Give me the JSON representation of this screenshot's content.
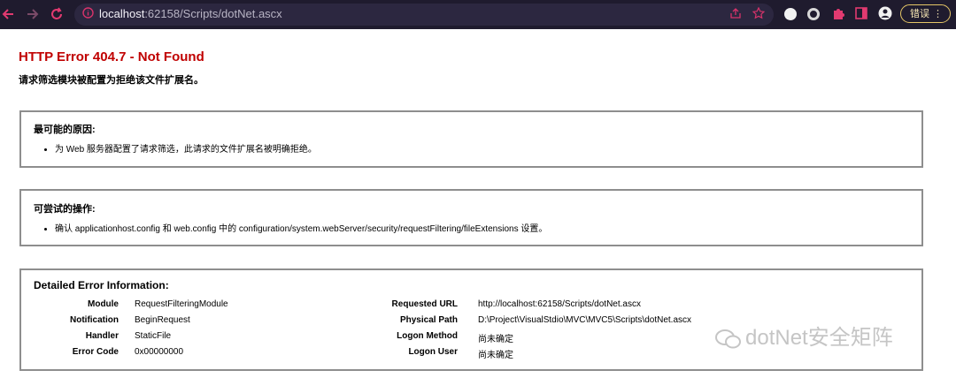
{
  "browser": {
    "url_host": "localhost",
    "url_rest": ":62158/Scripts/dotNet.ascx",
    "badge_label": "错误"
  },
  "error": {
    "title": "HTTP Error 404.7 - Not Found",
    "subtitle": "请求筛选模块被配置为拒绝该文件扩展名。"
  },
  "causes": {
    "heading": "最可能的原因:",
    "item": "为 Web 服务器配置了请求筛选，此请求的文件扩展名被明确拒绝。"
  },
  "actions": {
    "heading": "可尝试的操作:",
    "item": "确认 applicationhost.config 和 web.config 中的 configuration/system.webServer/security/requestFiltering/fileExtensions 设置。"
  },
  "details": {
    "heading": "Detailed Error Information:",
    "left": [
      {
        "label": "Module",
        "value": "RequestFilteringModule"
      },
      {
        "label": "Notification",
        "value": "BeginRequest"
      },
      {
        "label": "Handler",
        "value": "StaticFile"
      },
      {
        "label": "Error Code",
        "value": "0x00000000"
      }
    ],
    "right": [
      {
        "label": "Requested URL",
        "value": "http://localhost:62158/Scripts/dotNet.ascx"
      },
      {
        "label": "Physical Path",
        "value": "D:\\Project\\VisualStdio\\MVC\\MVC5\\Scripts\\dotNet.ascx"
      },
      {
        "label": "Logon Method",
        "value": "尚未确定"
      },
      {
        "label": "Logon User",
        "value": "尚未确定"
      }
    ]
  },
  "watermark": "dotNet安全矩阵"
}
